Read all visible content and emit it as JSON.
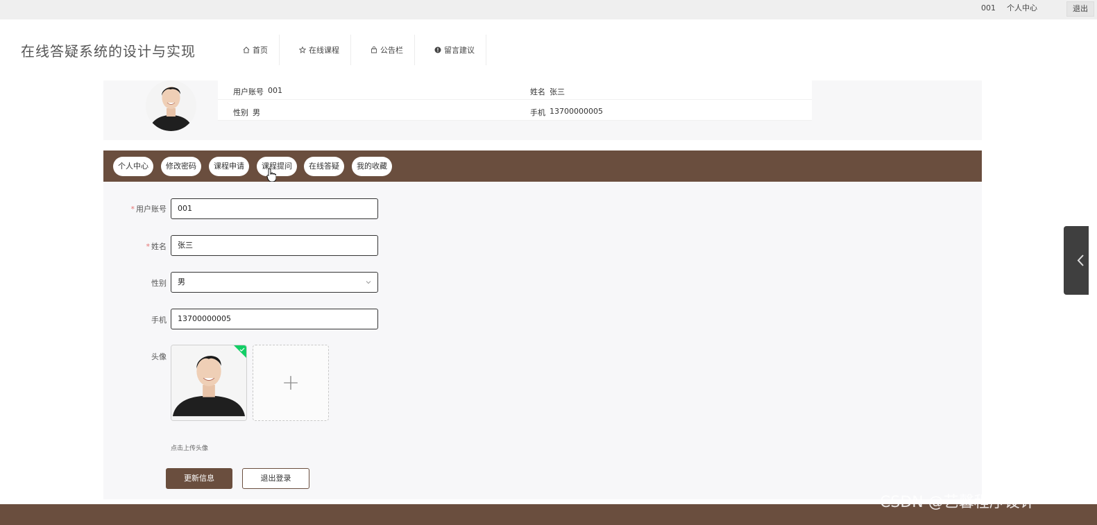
{
  "topbar": {
    "account": "001",
    "center_label": "个人中心",
    "logout_label": "退出"
  },
  "header": {
    "title": "在线答疑系统的设计与实现",
    "nav": [
      {
        "label": "首页",
        "icon": "home-icon"
      },
      {
        "label": "在线课程",
        "icon": "star-icon"
      },
      {
        "label": "公告栏",
        "icon": "bag-icon"
      },
      {
        "label": "留言建议",
        "icon": "alert-circle-icon"
      }
    ]
  },
  "profile": {
    "account_label": "用户账号",
    "account_value": "001",
    "name_label": "姓名",
    "name_value": "张三",
    "gender_label": "性别",
    "gender_value": "男",
    "phone_label": "手机",
    "phone_value": "13700000005"
  },
  "tabs": [
    {
      "label": "个人中心"
    },
    {
      "label": "修改密码"
    },
    {
      "label": "课程申请"
    },
    {
      "label": "课程提问"
    },
    {
      "label": "在线答疑"
    },
    {
      "label": "我的收藏"
    }
  ],
  "form": {
    "account_label": "用户账号",
    "account_value": "001",
    "name_label": "姓名",
    "name_value": "张三",
    "gender_label": "性别",
    "gender_value": "男",
    "phone_label": "手机",
    "phone_value": "13700000005",
    "avatar_label": "头像",
    "upload_hint": "点击上传头像",
    "update_button": "更新信息",
    "logout_button": "退出登录"
  },
  "watermark": "CSDN @艺馨程序设计",
  "colors": {
    "brand": "#6a4e3e",
    "success": "#13ce66"
  }
}
